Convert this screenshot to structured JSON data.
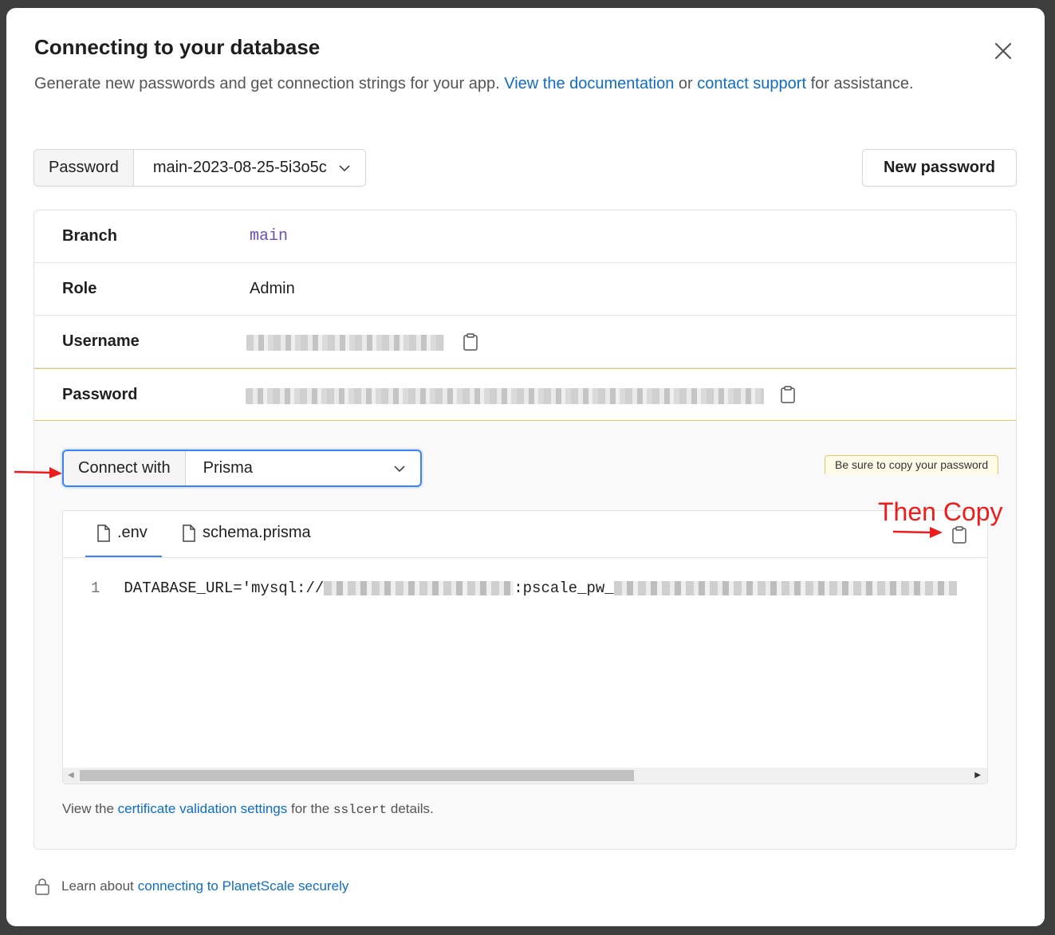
{
  "modal": {
    "title": "Connecting to your database",
    "subtitle_text": "Generate new passwords and get connection strings for your app.",
    "docs_link": "View the documentation",
    "or_text": "or",
    "support_link": "contact support",
    "tail_text": "for assistance."
  },
  "password_select": {
    "label": "Password",
    "value": "main-2023-08-25-5i3o5c"
  },
  "new_password_button": "New password",
  "details": {
    "branch_label": "Branch",
    "branch_value": "main",
    "role_label": "Role",
    "role_value": "Admin",
    "username_label": "Username",
    "password_label": "Password",
    "password_hint": "Be sure to copy your password"
  },
  "connect": {
    "label": "Connect with",
    "value": "Prisma"
  },
  "code": {
    "tabs": [
      ".env",
      "schema.prisma"
    ],
    "line_number": "1",
    "line_prefix": "DATABASE_URL='mysql://",
    "line_mid": ":pscale_pw_"
  },
  "cert_note": {
    "prefix": "View the",
    "link": "certificate validation settings",
    "middle": "for the",
    "code": "sslcert",
    "suffix": "details."
  },
  "footer": {
    "text": "Learn about",
    "link": "connecting to PlanetScale securely"
  },
  "annotation": {
    "text": "Then Copy",
    "color": "#ee1c1c"
  },
  "colors": {
    "link": "#0f6dc3",
    "focus": "#3b82f6",
    "warning_border": "#e6c766"
  },
  "icons": [
    "close-icon",
    "chevron-down-icon",
    "clipboard-icon",
    "file-icon",
    "lock-icon"
  ]
}
